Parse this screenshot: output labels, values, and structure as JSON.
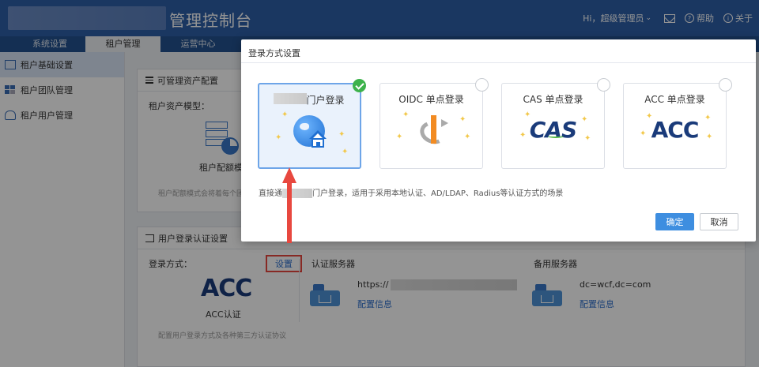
{
  "header": {
    "title": "管理控制台",
    "greeting": "Hi，超级管理员",
    "help": "帮助",
    "about": "关于"
  },
  "nav": {
    "tabs": [
      {
        "label": "系统设置"
      },
      {
        "label": "租户管理"
      },
      {
        "label": "运营中心"
      }
    ]
  },
  "sidebar": {
    "items": [
      {
        "label": "租户基础设置"
      },
      {
        "label": "租户团队管理"
      },
      {
        "label": "租户用户管理"
      }
    ]
  },
  "panel_assets": {
    "title": "可管理资产配置",
    "model_label": "租户资产模型：",
    "caption": "租户配额模",
    "hint": "租户配额模式会将着每个团"
  },
  "panel_login": {
    "title": "用户登录认证设置",
    "method_label": "登录方式：",
    "set_link": "设置",
    "acc_logo": "ACC",
    "acc_caption": "ACC认证",
    "hint": "配置用户登录方式及各种第三方认证协议",
    "auth_server_label": "认证服务器",
    "auth_server_url": "https://",
    "auth_server_config": "配置信息",
    "backup_server_label": "备用服务器",
    "backup_server_value": "dc=wcf,dc=com",
    "backup_server_config": "配置信息"
  },
  "modal": {
    "title": "登录方式设置",
    "cards": [
      {
        "label": "门户登录",
        "selected": true
      },
      {
        "label": "OIDC 单点登录",
        "selected": false
      },
      {
        "label": "CAS 单点登录",
        "selected": false,
        "logo": "CAS"
      },
      {
        "label": "ACC 单点登录",
        "selected": false,
        "logo": "ACC"
      }
    ],
    "desc_prefix": "直接通",
    "desc_suffix": "门户登录，适用于采用本地认证、AD/LDAP、Radius等认证方式的场景",
    "ok_label": "确定",
    "cancel_label": "取消"
  },
  "colors": {
    "header_bg": "#2d5fa8",
    "nav_bg": "#24528f",
    "primary": "#3e8ee0",
    "selected_check": "#3db24b",
    "annotation": "#e8483f"
  }
}
